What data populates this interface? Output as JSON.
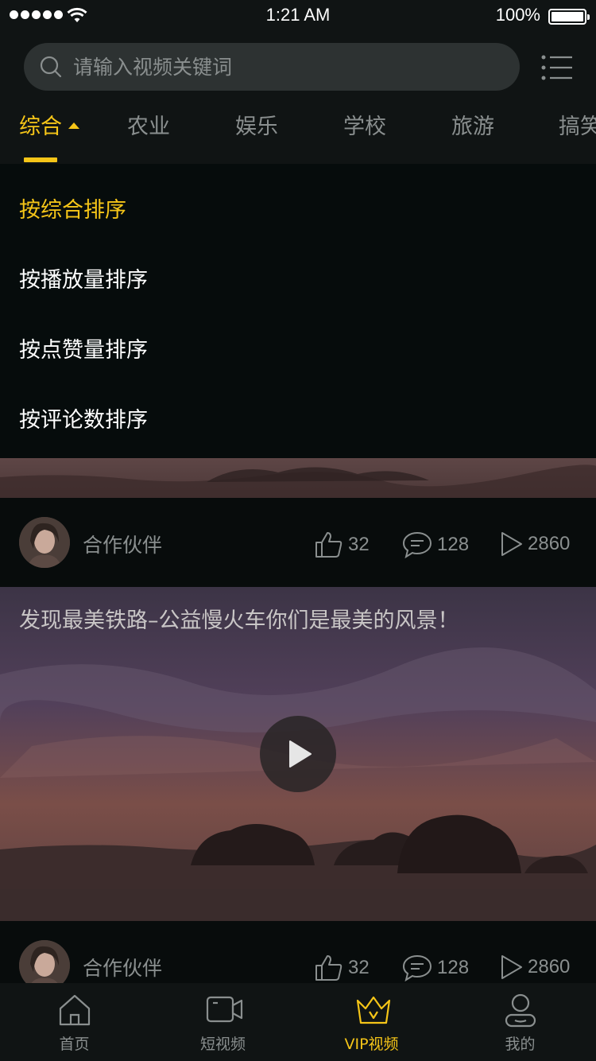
{
  "status_bar": {
    "time": "1:21 AM",
    "battery": "100%"
  },
  "search": {
    "placeholder": "请输入视频关键词"
  },
  "tabs": [
    {
      "label": "综合",
      "active": true
    },
    {
      "label": "农业"
    },
    {
      "label": "娱乐"
    },
    {
      "label": "学校"
    },
    {
      "label": "旅游"
    },
    {
      "label": "搞笑"
    }
  ],
  "sort_menu": {
    "items": [
      {
        "label": "按综合排序",
        "active": true
      },
      {
        "label": "按播放量排序"
      },
      {
        "label": "按点赞量排序"
      },
      {
        "label": "按评论数排序"
      }
    ]
  },
  "feed": [
    {
      "author": "合作伙伴",
      "likes": "32",
      "comments": "128",
      "plays": "2860"
    },
    {
      "title": "发现最美铁路–公益慢火车你们是最美的风景！",
      "author": "合作伙伴",
      "likes": "32",
      "comments": "128",
      "plays": "2860"
    }
  ],
  "tab_bar": {
    "items": [
      {
        "label": "首页",
        "icon": "home-icon"
      },
      {
        "label": "短视频",
        "icon": "video-camera-icon"
      },
      {
        "label": "VIP视频",
        "icon": "crown-icon",
        "active": true
      },
      {
        "label": "我的",
        "icon": "user-icon"
      }
    ]
  },
  "colors": {
    "accent": "#f5c518",
    "muted": "#8a8f8f",
    "background": "#080c0c"
  }
}
